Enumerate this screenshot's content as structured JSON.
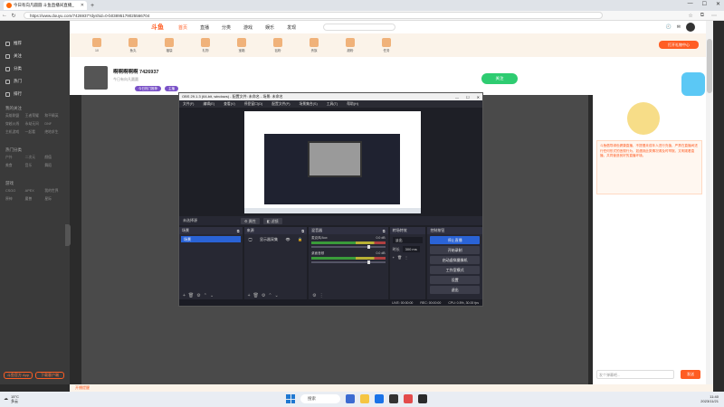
{
  "browser": {
    "tab_title": "今日有向凡圆圆 斗鱼直播间直播_",
    "url": "https://www.douyu.com/7426937?dyshid=0-b03895179025566704"
  },
  "header": {
    "logo": "斗鱼",
    "nav": [
      "首页",
      "直播",
      "分类",
      "游戏",
      "娱乐",
      "发现"
    ],
    "gift_button": "打开礼物中心"
  },
  "sidebar": {
    "items": [
      "推荐",
      "关注",
      "分类",
      "热门",
      "排行"
    ],
    "section1_title": "我的关注",
    "section1_grid": [
      "英雄联盟",
      "王者荣耀",
      "和平精英",
      "穿越火线",
      "永劫无间",
      "DNF",
      "主机游戏",
      "一起看",
      "绝地求生"
    ],
    "section2_title": "热门分类",
    "section2_grid": [
      "户外",
      "二次元",
      "颜值",
      "美食",
      "音乐",
      "舞蹈"
    ],
    "section3_title": "游戏",
    "section3_grid": [
      "CSGO",
      "APEX",
      "我的世界",
      "原神",
      "魔兽",
      "星际"
    ],
    "bottom_btns": [
      "斗鱼官方 App",
      "下载客户端"
    ]
  },
  "gifts": [
    "10",
    "鱼丸",
    "福袋",
    "礼物",
    "宝箱",
    "钻粉",
    "贵族",
    "超粉",
    "任务"
  ],
  "room": {
    "title": "啊啊啊啊啊 7426937",
    "sub": "今日有向凡圆圆",
    "tags": [
      "今日热门推荐",
      "主播"
    ],
    "follow": "关注"
  },
  "chat": {
    "notice": "斗鱼倡导绿色健康直播，不提倡未成年人进行充值，严禁在直播间进行任何形式的违规行为，如遇到此类情况请及时举报。文明观看直播，共同营造良好的直播环境。",
    "input_placeholder": "发个弹幕吧...",
    "send": "发送"
  },
  "bottom_strip_label": "开播提醒",
  "obs": {
    "title": "OBS 29.1.3 (64-bit, windows) - 配置文件: 未命名 - 场景: 未命名",
    "menu": [
      "文件(F)",
      "编辑(E)",
      "查看(V)",
      "停靠窗口(D)",
      "配置文件(P)",
      "场景集合(S)",
      "工具(T)",
      "帮助(H)"
    ],
    "toolbar": {
      "no_source": "未选择源",
      "props": "属性",
      "filters": "滤镜"
    },
    "docks": {
      "scenes": {
        "title": "场景",
        "items": [
          "场景"
        ]
      },
      "sources": {
        "title": "来源",
        "items": [
          "显示器采集"
        ]
      },
      "mixer": {
        "title": "混音器",
        "rows": [
          {
            "name": "桌面音频",
            "db": "0.0 dB"
          },
          {
            "name": "麦克风/Aux",
            "db": "0.0 dB"
          }
        ]
      },
      "transitions": {
        "title": "转场特效",
        "type": "淡出",
        "duration_label": "时长",
        "duration": "300 ms"
      },
      "controls": {
        "title": "控制按钮",
        "buttons": [
          "停止直播",
          "开始录制",
          "启动虚拟摄像机",
          "工作室模式",
          "设置",
          "退出"
        ]
      }
    },
    "status": {
      "live": "LIVE: 00:00:00",
      "rec": "REC: 00:00:00",
      "cpu": "CPU: 0.5%, 30.00 fps"
    }
  },
  "taskbar": {
    "weather_temp": "15°C",
    "weather_desc": "多云",
    "search": "搜索",
    "time": "11:40",
    "date": "2023/11/21"
  }
}
